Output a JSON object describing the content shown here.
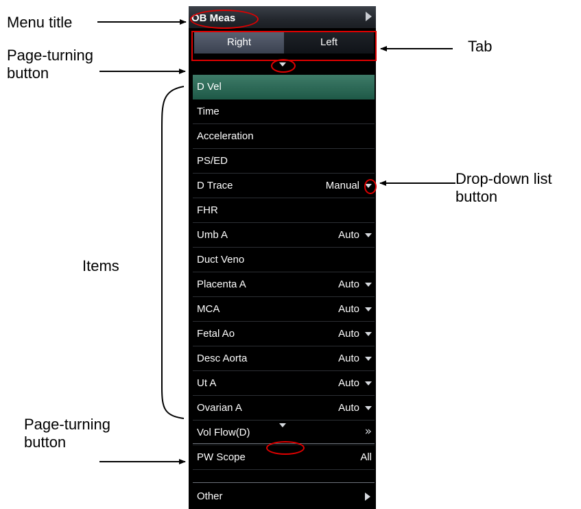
{
  "menu": {
    "title": "OB Meas",
    "tabs": [
      {
        "label": "Right",
        "selected": true
      },
      {
        "label": "Left",
        "selected": false
      }
    ],
    "items": [
      {
        "label": "D Vel",
        "value": "",
        "control": "none",
        "selected": true
      },
      {
        "label": "Time",
        "value": "",
        "control": "none"
      },
      {
        "label": "Acceleration",
        "value": "",
        "control": "none"
      },
      {
        "label": "PS/ED",
        "value": "",
        "control": "none"
      },
      {
        "label": "D Trace",
        "value": "Manual",
        "control": "dropdown"
      },
      {
        "label": "FHR",
        "value": "",
        "control": "none"
      },
      {
        "label": "Umb A",
        "value": "Auto",
        "control": "dropdown"
      },
      {
        "label": "Duct Veno",
        "value": "",
        "control": "none"
      },
      {
        "label": "Placenta A",
        "value": "Auto",
        "control": "dropdown"
      },
      {
        "label": "MCA",
        "value": "Auto",
        "control": "dropdown"
      },
      {
        "label": "Fetal Ao",
        "value": "Auto",
        "control": "dropdown"
      },
      {
        "label": "Desc Aorta",
        "value": "Auto",
        "control": "dropdown"
      },
      {
        "label": "Ut A",
        "value": "Auto",
        "control": "dropdown"
      },
      {
        "label": "Ovarian A",
        "value": "Auto",
        "control": "dropdown"
      },
      {
        "label": "Vol Flow(D)",
        "value": "",
        "control": "submenu-chevron"
      }
    ],
    "scope": {
      "label": "PW Scope",
      "value": "All"
    },
    "other": {
      "label": "Other",
      "control": "submenu-arrow"
    }
  },
  "callouts": {
    "menu_title": "Menu title",
    "page_turning_top_line1": "Page-turning",
    "page_turning_top_line2": "button",
    "tab": "Tab",
    "items": "Items",
    "dropdown_line1": "Drop-down list",
    "dropdown_line2": "button",
    "page_turning_bottom_line1": "Page-turning",
    "page_turning_bottom_line2": "button"
  },
  "colors": {
    "panel_background": "#000000",
    "selected_item": "#2f6b58",
    "active_tab": "#4a5262",
    "highlight_ring": "#e00000"
  }
}
